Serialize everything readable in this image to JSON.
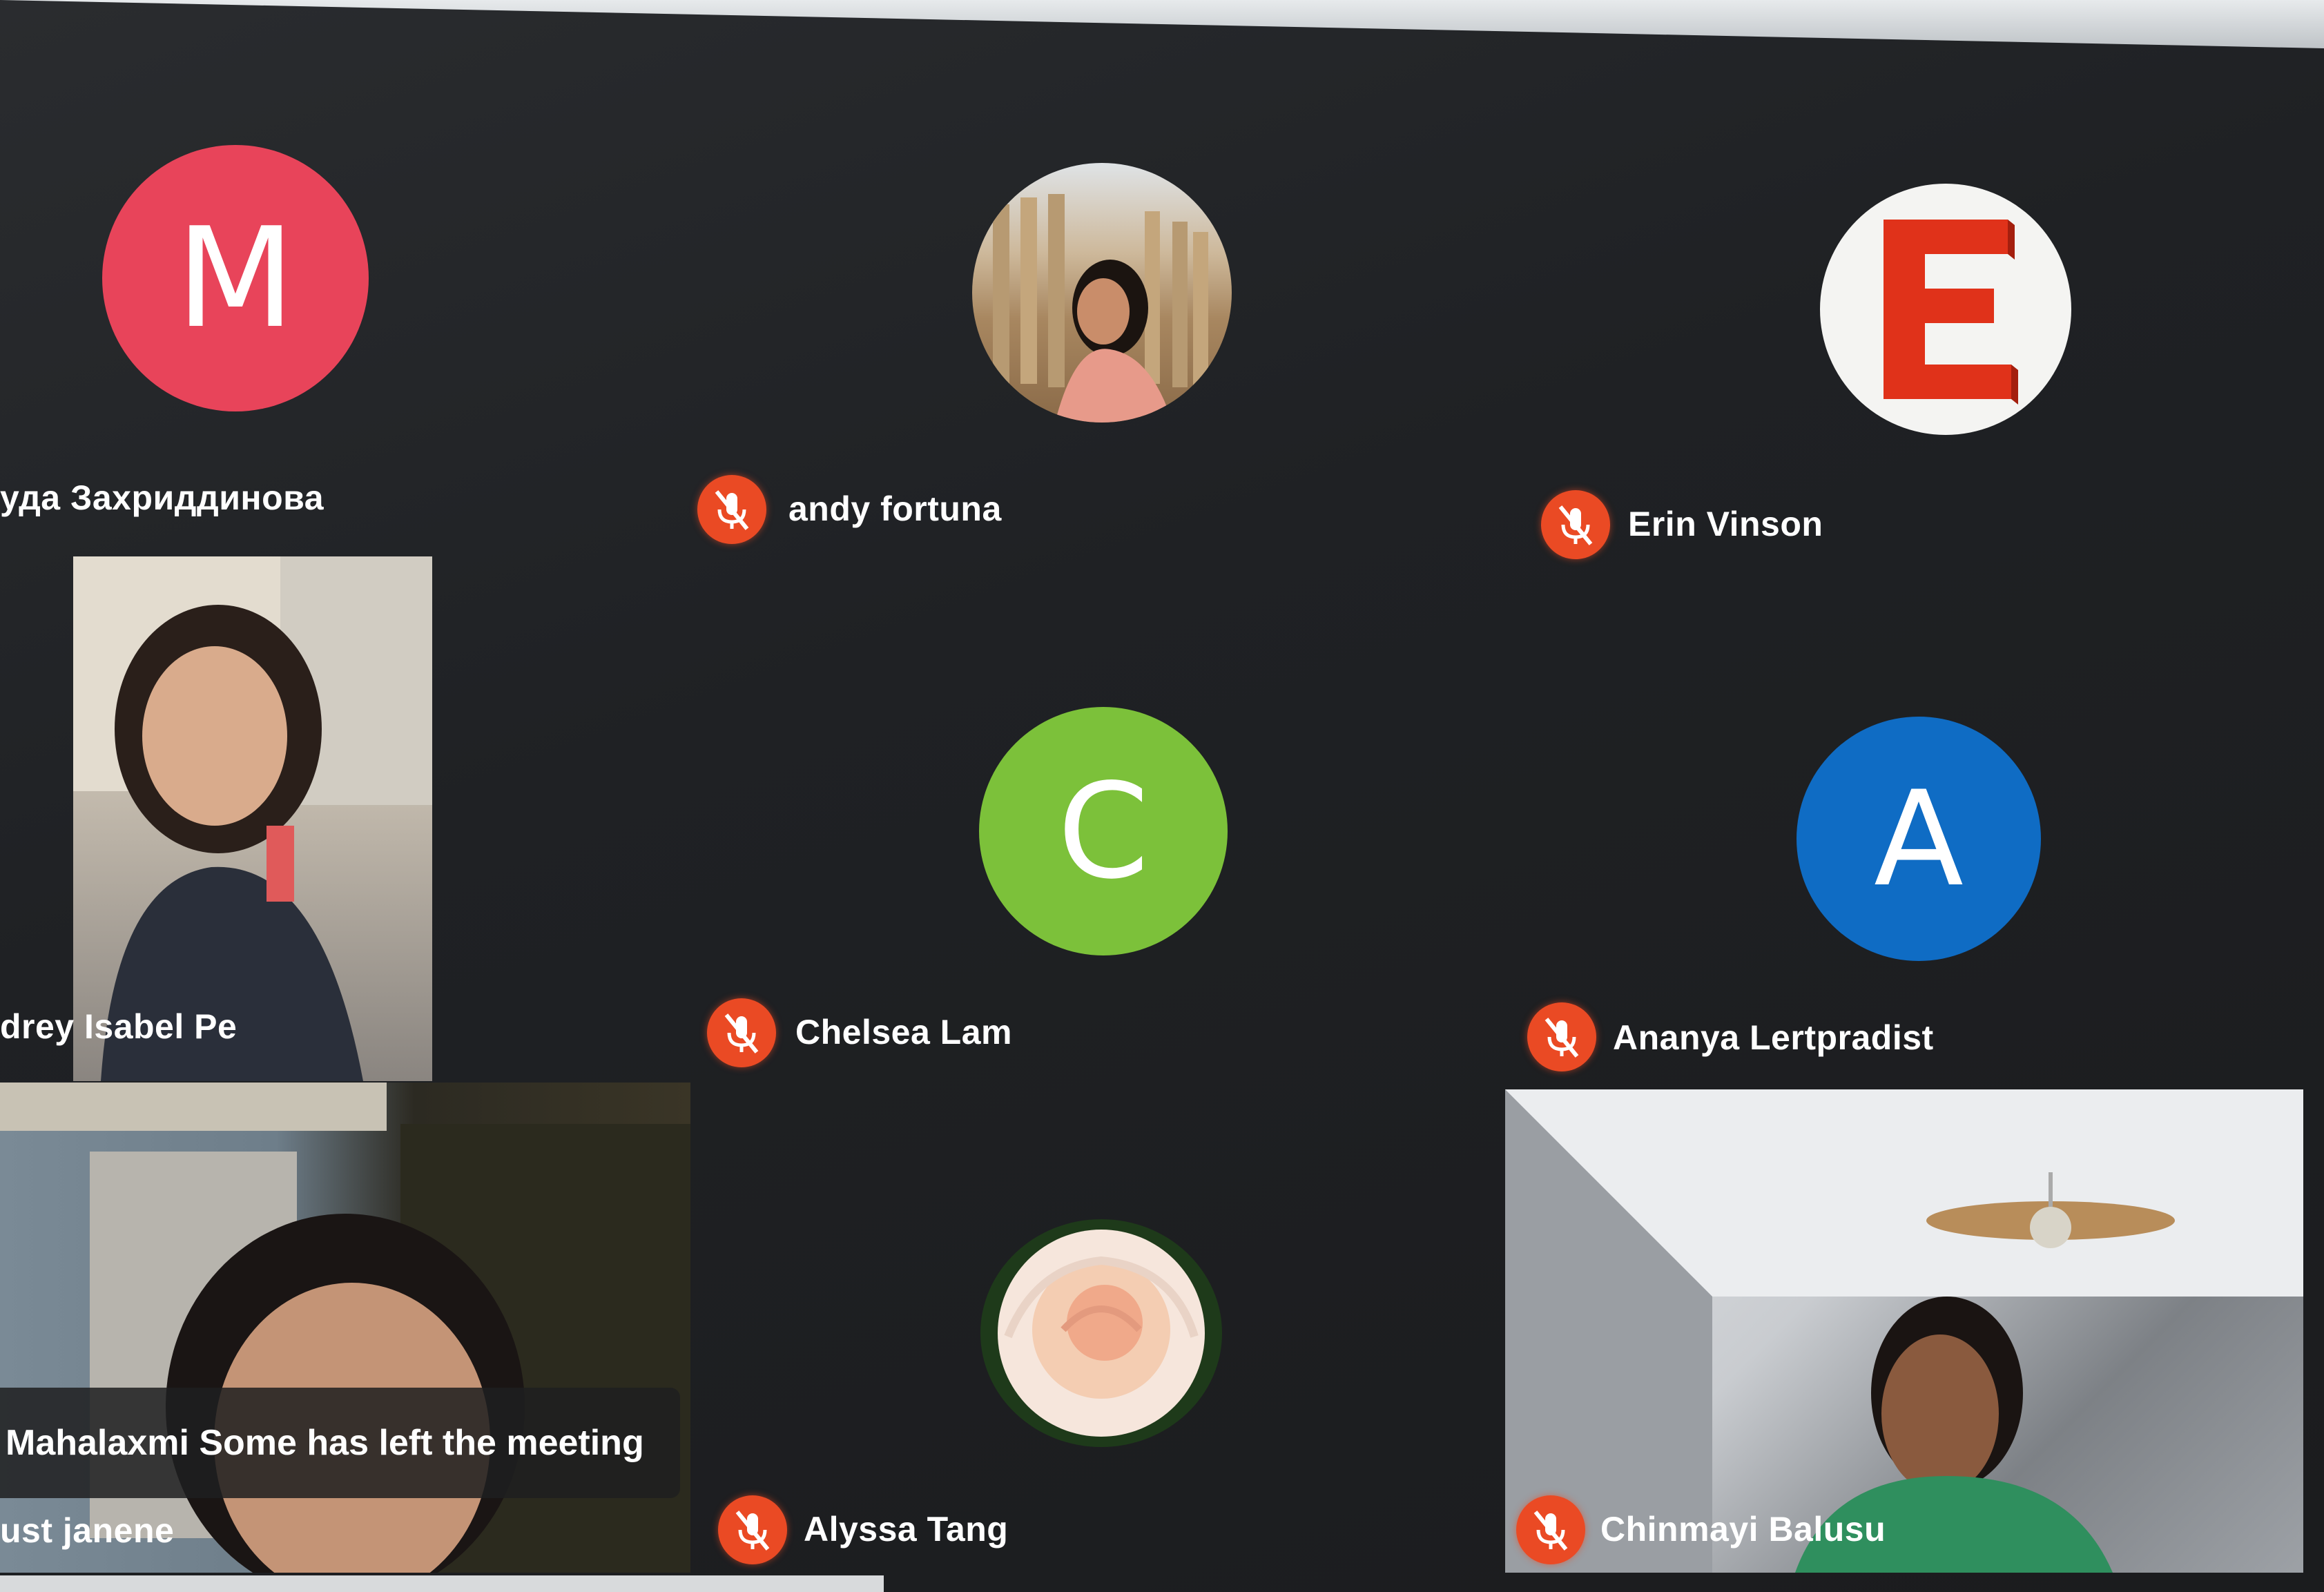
{
  "participants": [
    {
      "name": "уда Захриддинова",
      "avatar_letter": "M",
      "avatar_color": "#e8445a"
    },
    {
      "name": "andy fortuna",
      "avatar_type": "photo-columns",
      "muted": true
    },
    {
      "name": "Erin Vinson",
      "avatar_letter": "E",
      "avatar_color": "#ffffff",
      "letter_color": "#e0321a",
      "muted": true
    },
    {
      "name": "drey Isabel Pe",
      "avatar_type": "video"
    },
    {
      "name": "Chelsea Lam",
      "avatar_letter": "C",
      "avatar_color": "#7cc13a",
      "muted": true
    },
    {
      "name": "Ananya Lertpradist",
      "avatar_letter": "A",
      "avatar_color": "#0f6cc4",
      "muted": true
    },
    {
      "name": "ust janene",
      "avatar_type": "video"
    },
    {
      "name": "Alyssa Tang",
      "avatar_type": "photo-rose",
      "muted": true
    },
    {
      "name": "Chinmayi Balusu",
      "avatar_type": "video",
      "muted": true
    }
  ],
  "notification": "Mahalaxmi Some has left the meeting",
  "colors": {
    "background": "#1f2124",
    "mic_muted": "#ea4a24"
  },
  "icons": {
    "mic": "mic-off-icon"
  }
}
